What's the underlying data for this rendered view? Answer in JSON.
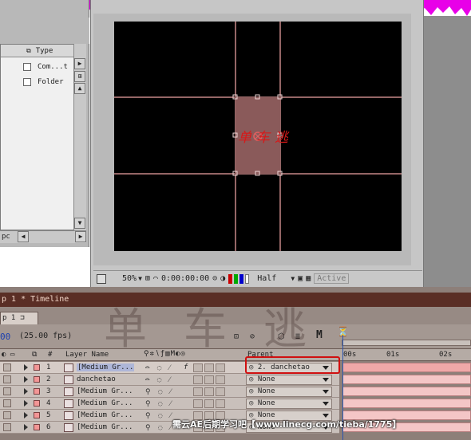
{
  "project_panel": {
    "column_type": "Type",
    "rows": [
      {
        "type": "Com...t"
      },
      {
        "type": "Folder"
      }
    ],
    "hscroll_label": "pc"
  },
  "viewer": {
    "zoom": "50%",
    "timecode": "0:00:00:00",
    "resolution": "Half",
    "status": "Active",
    "canvas_text": "单车逃"
  },
  "timeline": {
    "title": "p 1 * Timeline",
    "tab_label": "p 1",
    "current_time": "00",
    "fps": "(25.00 fps)",
    "motion_label": "M",
    "headers": {
      "num": "#",
      "layer_name": "Layer Name",
      "parent": "Parent",
      "t0": "00s",
      "t1": "01s",
      "t2": "02s"
    },
    "layers": [
      {
        "num": "1",
        "name": "[Medium Gr...",
        "parent": "2. danchetao",
        "fx": "f"
      },
      {
        "num": "2",
        "name": "danchetao",
        "parent": "None",
        "fx": ""
      },
      {
        "num": "3",
        "name": "[Medium Gr...",
        "parent": "None",
        "fx": ""
      },
      {
        "num": "4",
        "name": "[Medium Gr...",
        "parent": "None",
        "fx": ""
      },
      {
        "num": "5",
        "name": "[Medium Gr...",
        "parent": "None",
        "fx": ""
      },
      {
        "num": "6",
        "name": "[Medium Gr...",
        "parent": "None",
        "fx": ""
      }
    ]
  },
  "watermark": {
    "big": "单车逃",
    "footer": "需云AE后期学习吧【www.linecg.com/tieba/1775】"
  },
  "colors": {
    "magenta_banner": "#e800e8",
    "label_salmon": "#f39696",
    "bar_pink": "#f4c6c6",
    "highlight_red": "#d01010"
  }
}
